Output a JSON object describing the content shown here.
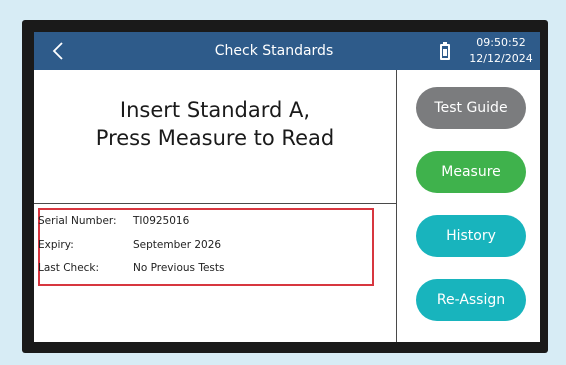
{
  "header": {
    "title": "Check Standards",
    "time": "09:50:52",
    "date": "12/12/2024",
    "back_icon": "chevron-left-icon",
    "battery_icon": "battery-icon",
    "background": "#2e5b8a"
  },
  "instruction": {
    "line1": "Insert Standard A,",
    "line2": "Press Measure to Read"
  },
  "info": {
    "serial_label": "Serial Number:",
    "serial_value": "TI0925016",
    "expiry_label": "Expiry:",
    "expiry_value": "September 2026",
    "last_check_label": "Last Check:",
    "last_check_value": "No Previous Tests",
    "highlight_color": "#d7363f"
  },
  "buttons": {
    "test_guide": "Test Guide",
    "measure": "Measure",
    "history": "History",
    "reassign": "Re-Assign"
  },
  "colors": {
    "test_guide": "#7b7c7e",
    "measure": "#3fb24c",
    "history": "#18b4bd",
    "reassign": "#18b4bd"
  }
}
